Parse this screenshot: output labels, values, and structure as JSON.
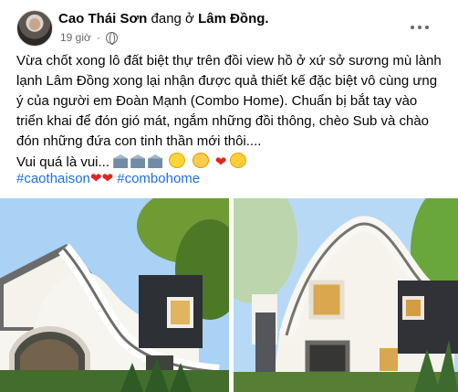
{
  "post": {
    "author": "Cao Thái Sơn",
    "status": "đang ở",
    "place": "Lâm Đồng.",
    "time": "19 giờ",
    "text_lines": [
      "Vừa chốt xong lô đất biệt thự trên đồi view hồ ở xứ sở sương mù lành",
      "lạnh Lâm Đồng xong lại nhận được quả thiết kế đặc biệt vô cùng ưng",
      "ý của người em Đoàn Mạnh (Combo Home). Chuẩn bị bắt tay vào",
      "triển khai để đón gió mát, ngắm những đồi thông, chèo Sub và chào",
      "đón những đứa con tinh thần mới thôi...."
    ],
    "final_line": "Vui quá là vui...",
    "hashtags": [
      "#caothaison",
      "#combohome"
    ],
    "heart_symbols": [
      "❤",
      "❤"
    ]
  },
  "icons": [
    "globe-icon",
    "more-icon",
    "bank-icon",
    "laughing-face-icon",
    "smiling-face-icon",
    "heart-icon",
    "heart-eyes-icon"
  ],
  "colors": {
    "link": "#216fdb",
    "muted": "#65676b",
    "heart": "#e02424"
  }
}
